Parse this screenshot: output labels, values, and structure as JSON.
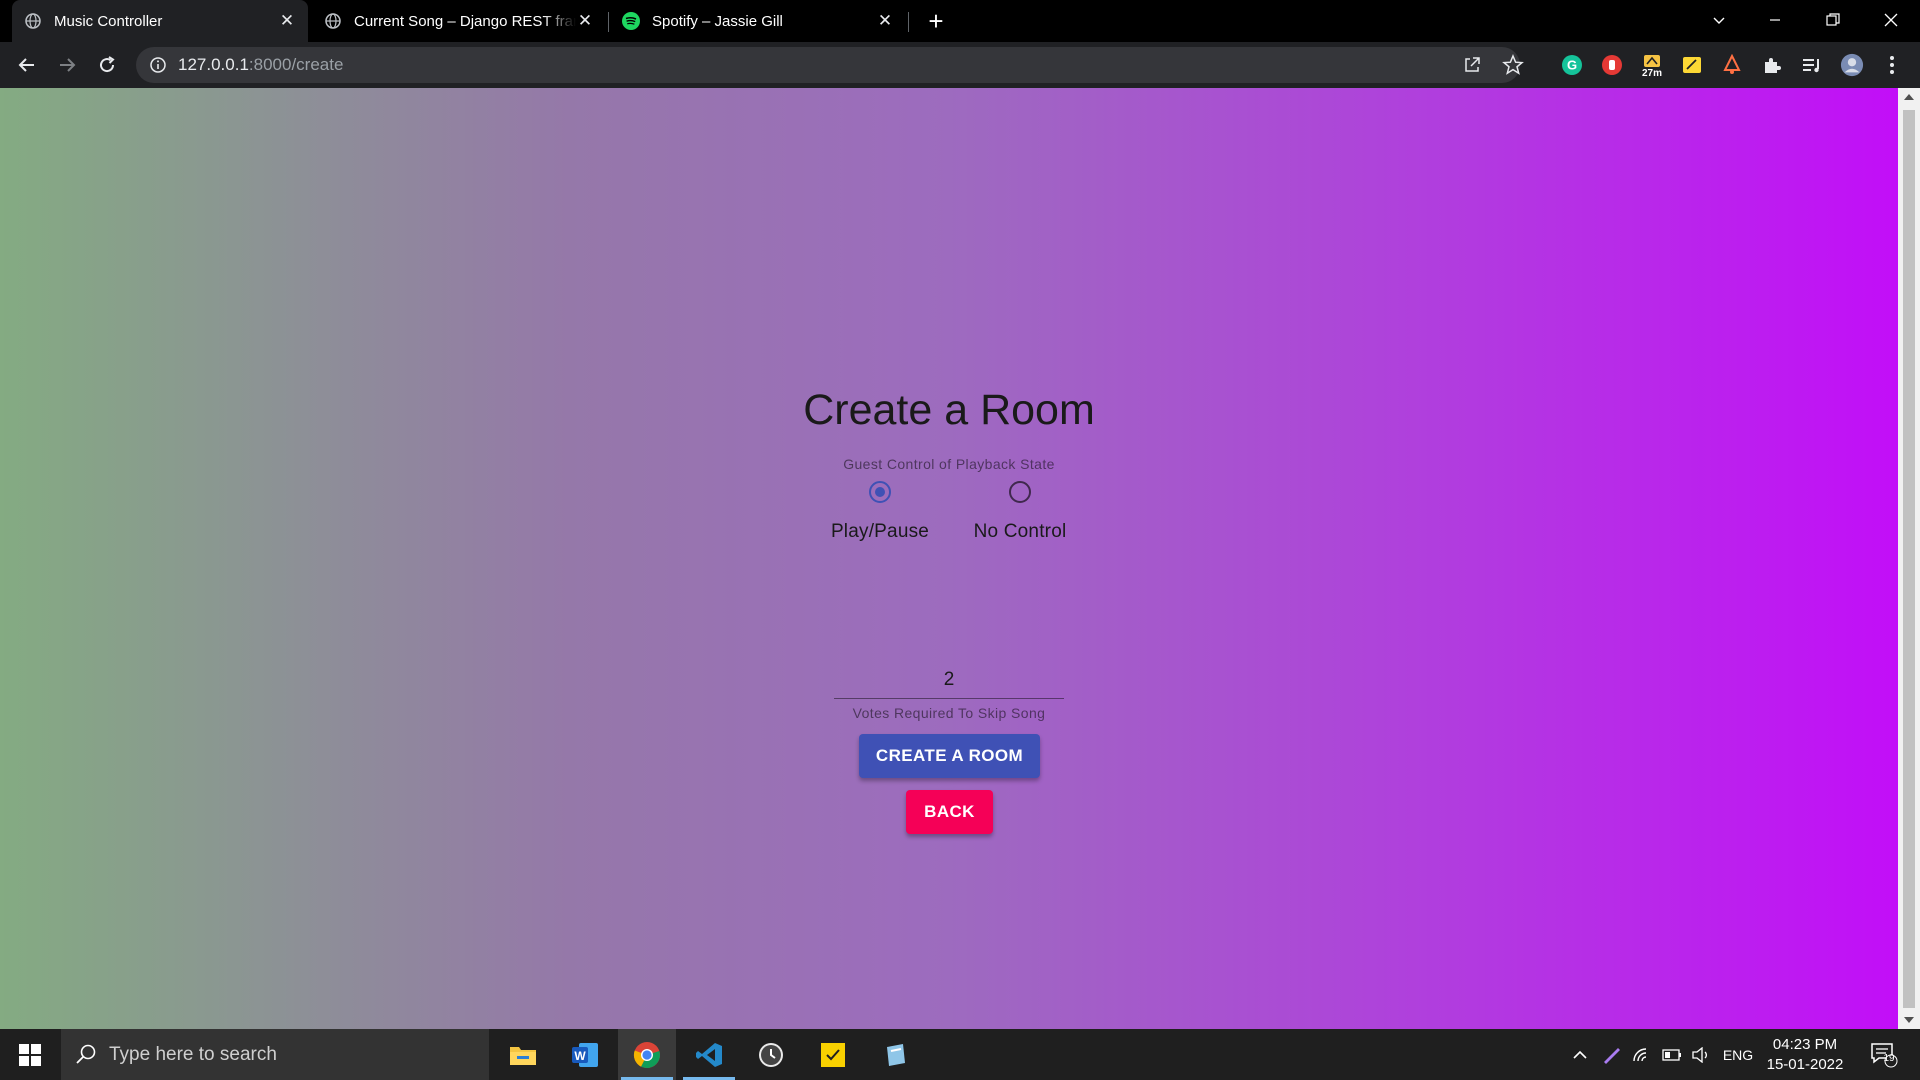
{
  "browser": {
    "tabs": [
      {
        "title": "Music Controller",
        "favicon": "globe-icon",
        "active": true
      },
      {
        "title": "Current Song – Django REST framework",
        "favicon": "globe-icon",
        "active": false
      },
      {
        "title": "Spotify – Jassie Gill",
        "favicon": "spotify-icon",
        "active": false
      }
    ],
    "url_host": "127.0.0.1",
    "url_path": ":8000/create",
    "extension_badge": "27m"
  },
  "form": {
    "title": "Create a Room",
    "helper": "Guest Control of Playback State",
    "options": [
      {
        "label": "Play/Pause",
        "checked": true
      },
      {
        "label": "No Control",
        "checked": false
      }
    ],
    "votes_value": "2",
    "votes_helper": "Votes Required To Skip Song",
    "create_label": "CREATE A ROOM",
    "back_label": "BACK"
  },
  "colors": {
    "primary": "#3f51b5",
    "secondary": "#f50057",
    "gradient_start": "#84ab82",
    "gradient_end": "#c20ef8"
  },
  "taskbar": {
    "search_placeholder": "Type here to search",
    "language": "ENG",
    "time": "04:23 PM",
    "date": "15-01-2022",
    "notification_count": "19"
  }
}
